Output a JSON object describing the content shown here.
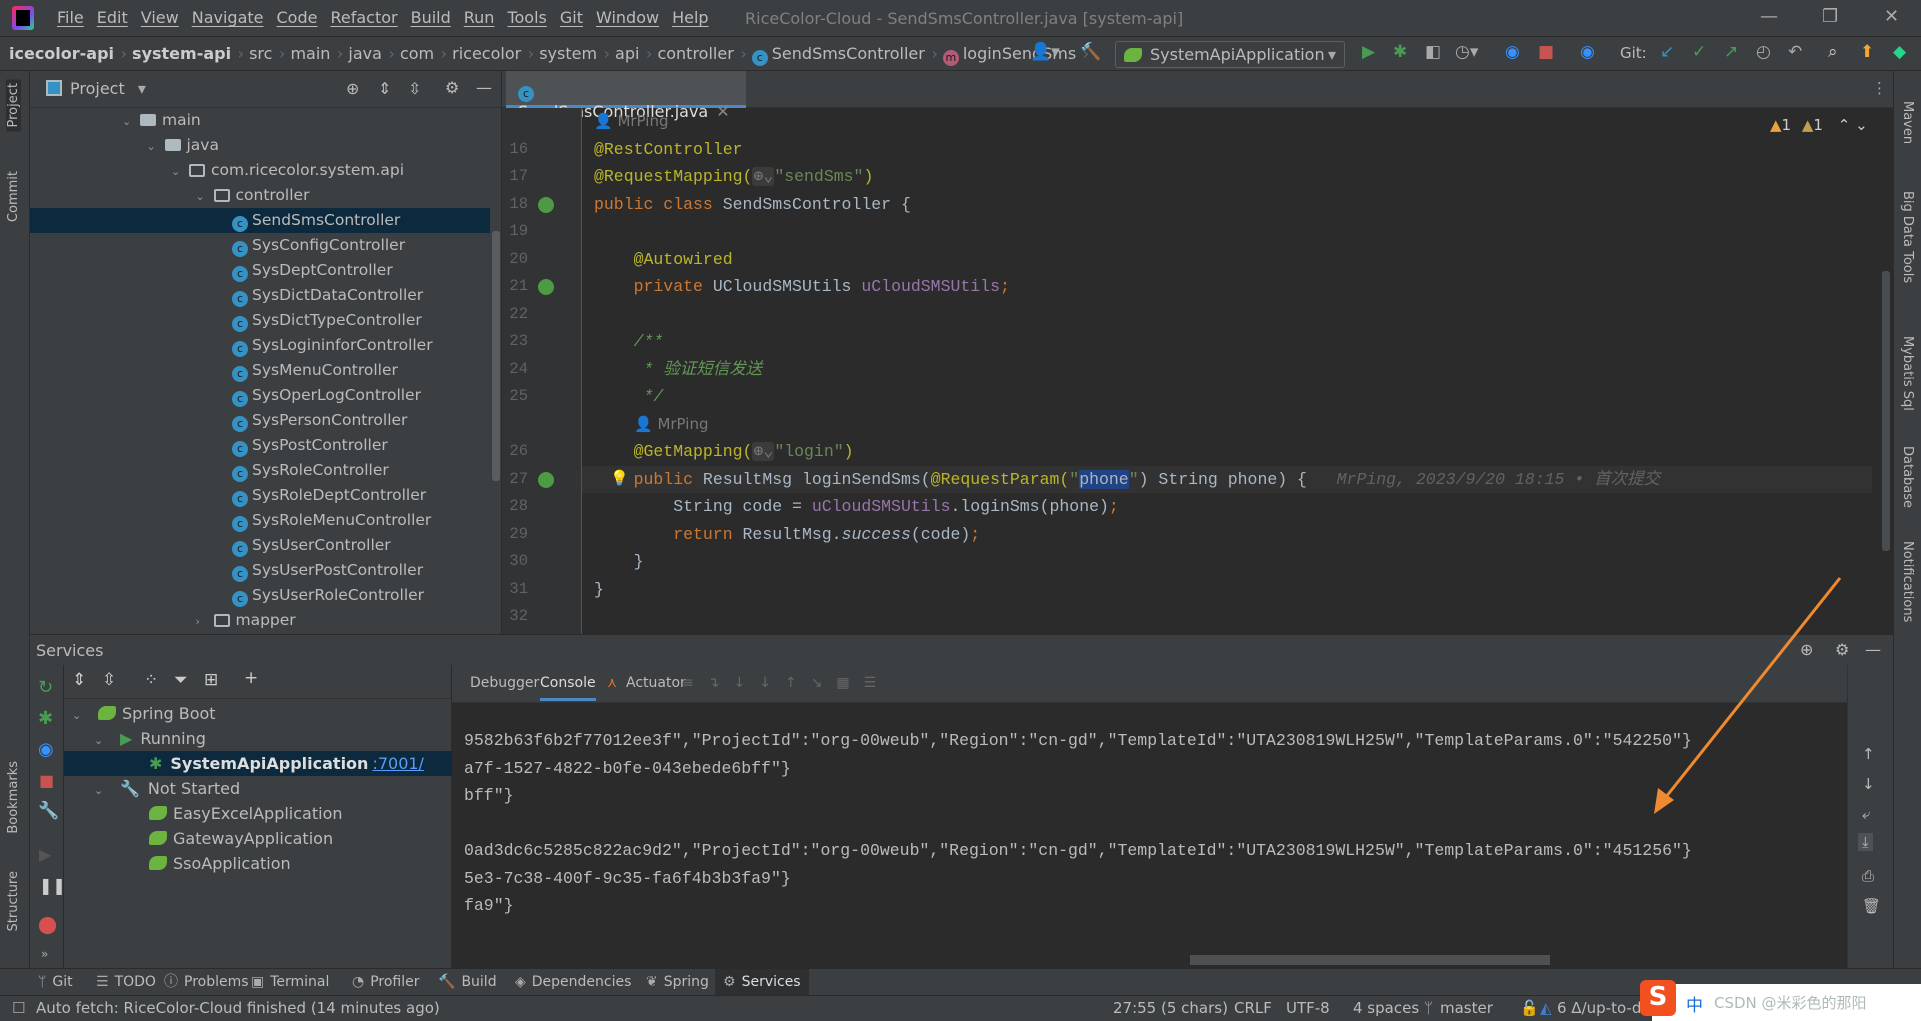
{
  "window": {
    "title": "RiceColor-Cloud - SendSmsController.java [system-api]",
    "menu": [
      "File",
      "Edit",
      "View",
      "Navigate",
      "Code",
      "Refactor",
      "Build",
      "Run",
      "Tools",
      "Git",
      "Window",
      "Help"
    ]
  },
  "breadcrumb": [
    "icecolor-api",
    "system-api",
    "src",
    "main",
    "java",
    "com",
    "ricecolor",
    "system",
    "api",
    "controller",
    "SendSmsController",
    "loginSendSms"
  ],
  "toolbar": {
    "run_config": "SystemApiApplication",
    "git_label": "Git:",
    "colors": {
      "run": "#499c54",
      "stop": "#c75450"
    }
  },
  "left_stripe": [
    "Project",
    "Commit",
    "Bookmarks",
    "Structure"
  ],
  "right_stripe": [
    "Maven",
    "Big Data Tools",
    "Mybatis Sql",
    "Database",
    "Notifications"
  ],
  "project": {
    "title": "Project",
    "items": [
      {
        "label": "main",
        "type": "folder",
        "level": 0,
        "expanded": true
      },
      {
        "label": "java",
        "type": "folder",
        "level": 1,
        "expanded": true
      },
      {
        "label": "com.ricecolor.system.api",
        "type": "package",
        "level": 2,
        "expanded": true
      },
      {
        "label": "controller",
        "type": "package",
        "level": 3,
        "expanded": true
      },
      {
        "label": "SendSmsController",
        "type": "class",
        "level": 4,
        "selected": true
      },
      {
        "label": "SysConfigController",
        "type": "class",
        "level": 4
      },
      {
        "label": "SysDeptController",
        "type": "class",
        "level": 4
      },
      {
        "label": "SysDictDataController",
        "type": "class",
        "level": 4
      },
      {
        "label": "SysDictTypeController",
        "type": "class",
        "level": 4
      },
      {
        "label": "SysLogininforController",
        "type": "class",
        "level": 4
      },
      {
        "label": "SysMenuController",
        "type": "class",
        "level": 4
      },
      {
        "label": "SysOperLogController",
        "type": "class",
        "level": 4
      },
      {
        "label": "SysPersonController",
        "type": "class",
        "level": 4
      },
      {
        "label": "SysPostController",
        "type": "class",
        "level": 4
      },
      {
        "label": "SysRoleController",
        "type": "class",
        "level": 4
      },
      {
        "label": "SysRoleDeptController",
        "type": "class",
        "level": 4
      },
      {
        "label": "SysRoleMenuController",
        "type": "class",
        "level": 4
      },
      {
        "label": "SysUserController",
        "type": "class",
        "level": 4
      },
      {
        "label": "SysUserPostController",
        "type": "class",
        "level": 4
      },
      {
        "label": "SysUserRoleController",
        "type": "class",
        "level": 4
      },
      {
        "label": "mapper",
        "type": "package",
        "level": 3,
        "expanded": false
      }
    ]
  },
  "editor": {
    "tab": "SendSmsController.java",
    "warnings": "1",
    "weak_warnings": "1",
    "lines": [
      {
        "author": "MrPing"
      },
      {
        "n": "16",
        "tokens": [
          [
            "@RestController",
            "ann"
          ]
        ]
      },
      {
        "n": "17",
        "tokens": [
          [
            "@RequestMapping(",
            "ann"
          ],
          [
            "⊕⌄",
            "hint"
          ],
          [
            "\"sendSms\"",
            "str"
          ],
          [
            ")",
            "ann"
          ]
        ]
      },
      {
        "n": "18",
        "tokens": [
          [
            "public class ",
            "kw"
          ],
          [
            "SendSmsController {",
            "def"
          ]
        ]
      },
      {
        "n": "19",
        "tokens": []
      },
      {
        "n": "20",
        "tokens": [
          [
            "    @Autowired",
            "ann"
          ]
        ]
      },
      {
        "n": "21",
        "tokens": [
          [
            "    private ",
            "kw"
          ],
          [
            "UCloudSMSUtils ",
            "def"
          ],
          [
            "uCloudSMSUtils",
            "fld"
          ],
          [
            ";",
            "kw"
          ]
        ]
      },
      {
        "n": "22",
        "tokens": []
      },
      {
        "n": "23",
        "tokens": [
          [
            "    /**",
            "com"
          ]
        ]
      },
      {
        "n": "24",
        "tokens": [
          [
            "     * 验证短信发送",
            "com"
          ]
        ]
      },
      {
        "n": "25",
        "tokens": [
          [
            "     */",
            "com"
          ]
        ]
      },
      {
        "author": "MrPing"
      },
      {
        "n": "26",
        "tokens": [
          [
            "    @GetMapping(",
            "ann"
          ],
          [
            "⊕⌄",
            "hint"
          ],
          [
            "\"login\"",
            "str"
          ],
          [
            ")",
            "ann"
          ]
        ]
      },
      {
        "n": "27",
        "current": true,
        "tokens": [
          [
            "    public ",
            "kw"
          ],
          [
            "ResultMsg loginSendSms(",
            "def"
          ],
          [
            "@RequestParam(",
            "ann"
          ],
          [
            "\"",
            "str"
          ],
          [
            "phone",
            "sel"
          ],
          [
            "\"",
            "str"
          ],
          [
            ") String phone) {",
            "def"
          ],
          [
            "   MrPing, 2023/9/20 18:15 • 首次提交",
            "blame"
          ]
        ]
      },
      {
        "n": "28",
        "tokens": [
          [
            "        String code = ",
            "def"
          ],
          [
            "uCloudSMSUtils",
            "fld"
          ],
          [
            ".loginSms(phone)",
            "def"
          ],
          [
            ";",
            "kw"
          ]
        ]
      },
      {
        "n": "29",
        "tokens": [
          [
            "        return ",
            "kw"
          ],
          [
            "ResultMsg.",
            "def"
          ],
          [
            "success",
            "it"
          ],
          [
            "(code)",
            "def"
          ],
          [
            ";",
            "kw"
          ]
        ]
      },
      {
        "n": "30",
        "tokens": [
          [
            "    }",
            "def"
          ]
        ]
      },
      {
        "n": "31",
        "tokens": [
          [
            "}",
            "def"
          ]
        ]
      },
      {
        "n": "32",
        "tokens": []
      }
    ]
  },
  "services": {
    "title": "Services",
    "tree": [
      {
        "label": "Spring Boot",
        "level": 0,
        "icon": "spring"
      },
      {
        "label": "Running",
        "level": 1,
        "icon": "run"
      },
      {
        "label": "SystemApiApplication",
        "link": ":7001/",
        "level": 2,
        "icon": "debug",
        "selected": true
      },
      {
        "label": "Not Started",
        "level": 1,
        "icon": "wrench"
      },
      {
        "label": "EasyExcelApplication",
        "level": 2,
        "icon": "spring"
      },
      {
        "label": "GatewayApplication",
        "level": 2,
        "icon": "spring"
      },
      {
        "label": "SsoApplication",
        "level": 2,
        "icon": "spring"
      }
    ],
    "console_tabs": [
      "Debugger",
      "Console",
      "Actuator"
    ],
    "console_lines": [
      "9582b63f6b2f77012ee3f\",\"ProjectId\":\"org-00weub\",\"Region\":\"cn-gd\",\"TemplateId\":\"UTA230819WLH25W\",\"TemplateParams.0\":\"542250\"}",
      "a7f-1527-4822-b0fe-043ebede6bff\"}",
      "bff\"}",
      "",
      "0ad3dc6c5285c822ac9d2\",\"ProjectId\":\"org-00weub\",\"Region\":\"cn-gd\",\"TemplateId\":\"UTA230819WLH25W\",\"TemplateParams.0\":\"451256\"}",
      "5e3-7c38-400f-9c35-fa6f4b3b3fa9\"}",
      "fa9\"}"
    ]
  },
  "bottom_tabs": [
    "Git",
    "TODO",
    "Problems",
    "Terminal",
    "Profiler",
    "Build",
    "Dependencies",
    "Spring",
    "Services"
  ],
  "status": {
    "message": "Auto fetch: RiceColor-Cloud finished (14 minutes ago)",
    "position": "27:55 (5 chars)",
    "line_sep": "CRLF",
    "encoding": "UTF-8",
    "indent": "4 spaces",
    "branch": "master",
    "changes": "6 Δ/up-to-d"
  },
  "ime": {
    "lang": "中",
    "watermark": "CSDN @米彩色的那阳"
  },
  "annotation_arrow_color": "#f08a30"
}
